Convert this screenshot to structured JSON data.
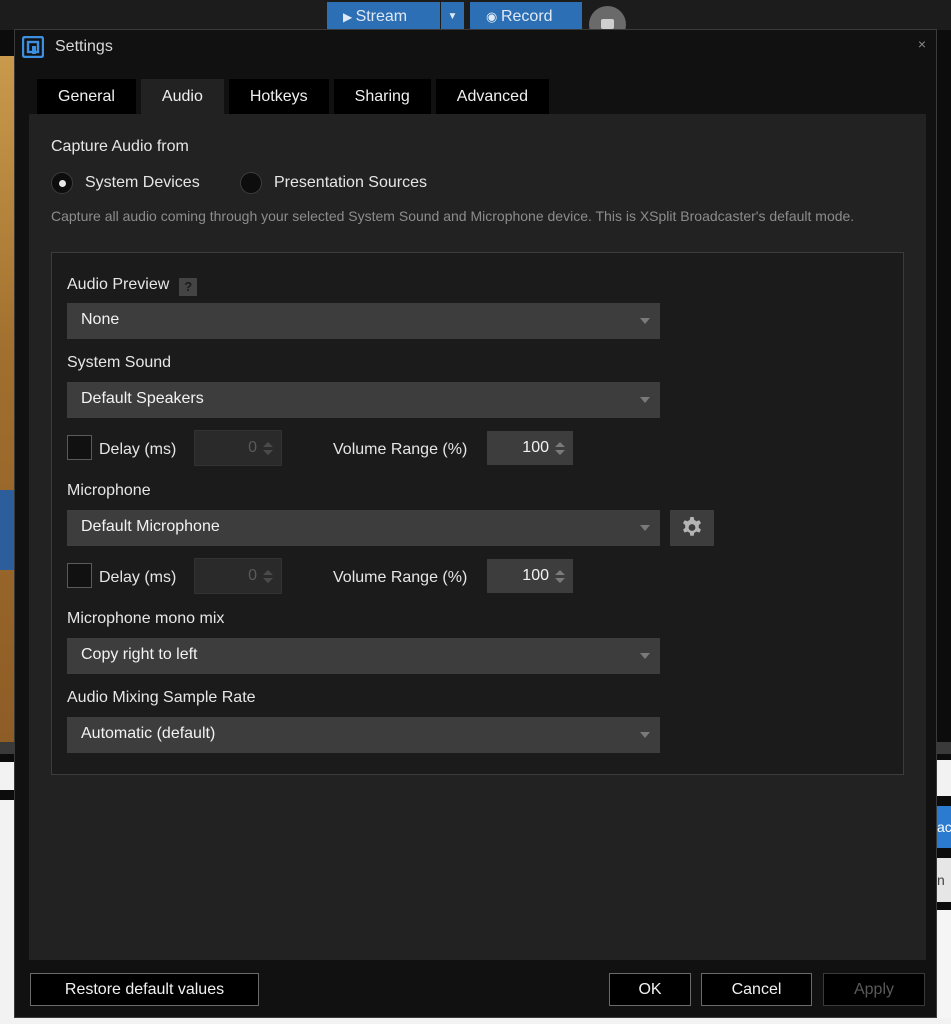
{
  "background_app": {
    "stream_label": "Stream",
    "record_label": "Record",
    "edge_text_1": "ac",
    "edge_text_2": "n"
  },
  "dialog": {
    "title": "Settings",
    "close_glyph": "×"
  },
  "tabs": [
    {
      "label": "General",
      "active": false
    },
    {
      "label": "Audio",
      "active": true
    },
    {
      "label": "Hotkeys",
      "active": false
    },
    {
      "label": "Sharing",
      "active": false
    },
    {
      "label": "Advanced",
      "active": false
    }
  ],
  "capture": {
    "title": "Capture Audio from",
    "options": [
      {
        "label": "System Devices",
        "selected": true
      },
      {
        "label": "Presentation Sources",
        "selected": false
      }
    ],
    "description": "Capture all audio coming through your selected System Sound and Microphone device. This is XSplit Broadcaster's default mode."
  },
  "audio_preview": {
    "label": "Audio Preview",
    "help_glyph": "?",
    "value": "None"
  },
  "system_sound": {
    "label": "System Sound",
    "value": "Default Speakers",
    "delay_label": "Delay (ms)",
    "delay_value": "0",
    "delay_checked": false,
    "volume_label": "Volume Range (%)",
    "volume_value": "100"
  },
  "microphone": {
    "label": "Microphone",
    "value": "Default Microphone",
    "delay_label": "Delay (ms)",
    "delay_value": "0",
    "delay_checked": false,
    "volume_label": "Volume Range (%)",
    "volume_value": "100"
  },
  "mono_mix": {
    "label": "Microphone mono mix",
    "value": "Copy right to left"
  },
  "sample_rate": {
    "label": "Audio Mixing Sample Rate",
    "value": "Automatic (default)"
  },
  "footer": {
    "restore_label": "Restore default values",
    "ok_label": "OK",
    "cancel_label": "Cancel",
    "apply_label": "Apply"
  },
  "colors": {
    "accent_blue": "#2d6fb4",
    "dialog_bg": "#111111",
    "content_bg": "#222222",
    "field_bg": "#3d3d3d"
  },
  "icons": [
    "xsplit-logo-icon",
    "close-icon",
    "help-icon",
    "gear-icon",
    "chevron-down-icon",
    "spinner-arrows-icon",
    "camera-icon",
    "play-icon",
    "record-dot-icon"
  ]
}
